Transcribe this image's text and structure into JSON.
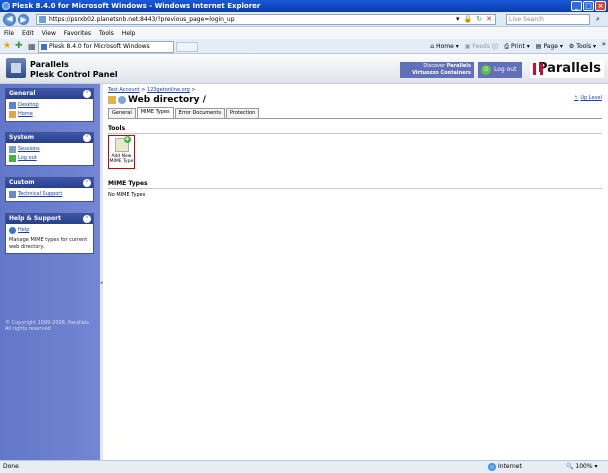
{
  "window": {
    "title": "Plesk 8.4.0 for Microsoft Windows - Windows Internet Explorer"
  },
  "address_bar": {
    "url": "https://psrxb02.planetsnb.net:8443/?previous_page=login_up",
    "search_placeholder": "Live Search"
  },
  "menu": [
    "File",
    "Edit",
    "View",
    "Favorites",
    "Tools",
    "Help"
  ],
  "tab": {
    "label": "Plesk 8.4.0 for Microsoft Windows"
  },
  "command_bar": {
    "home": "Home",
    "feeds": "Feeds (J)",
    "print": "Print",
    "page": "Page",
    "tools": "Tools"
  },
  "header": {
    "product_line1": "Parallels",
    "product_line2": "Plesk Control Panel",
    "discover_line1": "Discover",
    "discover_brand": "Parallels",
    "discover_line2": "Virtuozzo Containers",
    "logout_label": "Log out",
    "brand_logo": "Parallels"
  },
  "sidebar": {
    "general": {
      "title": "General",
      "items": [
        {
          "label": "Desktop",
          "icon": "desktop-icon"
        },
        {
          "label": "Home",
          "icon": "home-icon"
        }
      ]
    },
    "system": {
      "title": "System",
      "items": [
        {
          "label": "Sessions",
          "icon": "sessions-icon"
        },
        {
          "label": "Log out",
          "icon": "logout-icon"
        }
      ]
    },
    "custom": {
      "title": "Custom",
      "items": [
        {
          "label": "Technical Support",
          "icon": "support-icon"
        }
      ]
    },
    "help": {
      "title": "Help & Support",
      "link": "Help",
      "text": "Manage MIME types for current web directory."
    },
    "copyright": "© Copyright 1999-2008, Parallels All rights reserved"
  },
  "main": {
    "breadcrumb": [
      "Test Account",
      "123getonline.org"
    ],
    "title": "Web directory /",
    "up_level": "Up Level",
    "tabs": [
      "General",
      "MIME Types",
      "Error Documents",
      "Protection"
    ],
    "active_tab": "MIME Types",
    "tools_title": "Tools",
    "tool_button": "Add New MIME Type",
    "mime_title": "MIME Types",
    "empty_message": "No MIME Types"
  },
  "status": {
    "left": "Done",
    "zone": "Internet",
    "zoom": "100%"
  },
  "colors": {
    "sidebar_bg": "#6b7fcf",
    "panel_header": "#3049a0",
    "link": "#1a3ea8",
    "highlight_border": "#cc0000"
  }
}
